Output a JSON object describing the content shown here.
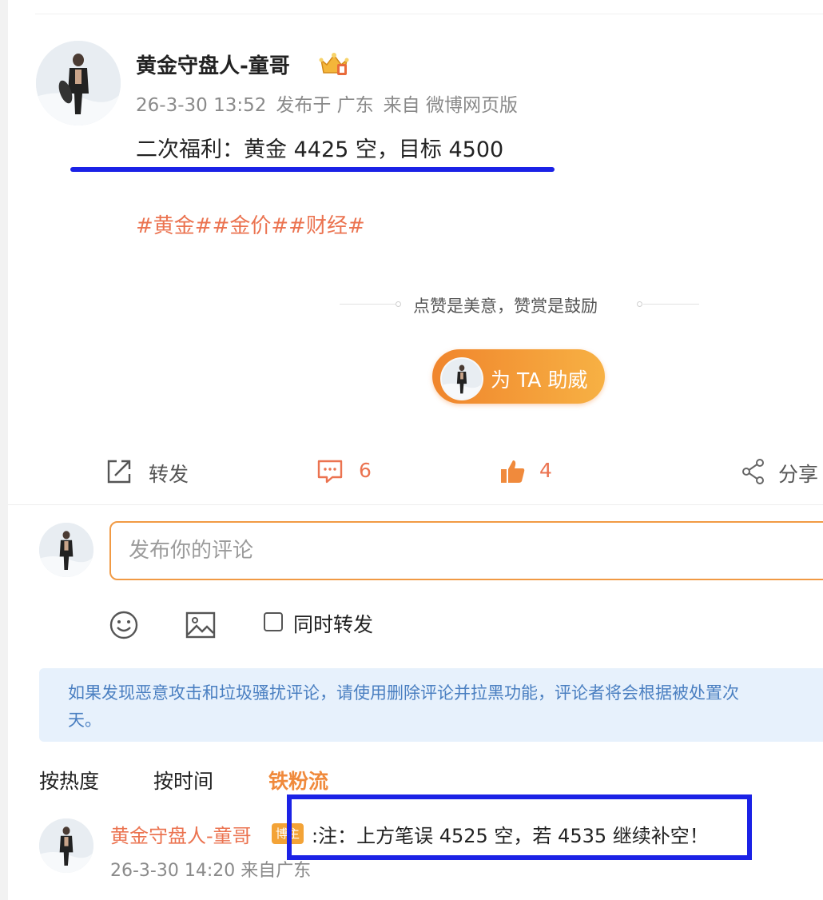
{
  "post": {
    "author": "黄金守盘人-童哥",
    "time": "26-3-30 13:52",
    "published_in": "发布于 广东",
    "source": "来自 微博网页版",
    "text": "二次福利：黄金 4425 空，目标 4500",
    "hashtags": [
      "#黄金#",
      "#金价#",
      "#财经#"
    ]
  },
  "reward": {
    "slogan": "点赞是美意，赞赏是鼓励",
    "button_label": "为 TA 助威"
  },
  "actions": {
    "repost_label": "转发",
    "comment_count": "6",
    "like_count": "4",
    "share_label": "分享"
  },
  "composer": {
    "placeholder": "发布你的评论",
    "repost_checkbox_label": "同时转发"
  },
  "notice": {
    "line1": "如果发现恶意攻击和垃圾骚扰评论，请使用删除评论并拉黑功能，评论者将会根据被处置次",
    "line2": "天。"
  },
  "sort_tabs": [
    "按热度",
    "按时间",
    "铁粉流"
  ],
  "active_sort": "铁粉流",
  "reply": {
    "author": "黄金守盘人-童哥",
    "badge": "博主",
    "text": ":注：上方笔误 4525 空，若 4535 继续补空！",
    "time": "26-3-30 14:20",
    "location": "来自广东"
  },
  "colors": {
    "accent": "#eb7350",
    "orange_button_start": "#f0852c",
    "orange_button_end": "#f7b144",
    "annotation_blue": "#1b22e6",
    "notice_bg": "#e7f1fc",
    "notice_text": "#4a7fc1"
  },
  "icons": [
    "crown-icon",
    "repost-icon",
    "comment-icon",
    "like-icon",
    "share-icon",
    "emoji-icon",
    "image-icon"
  ]
}
